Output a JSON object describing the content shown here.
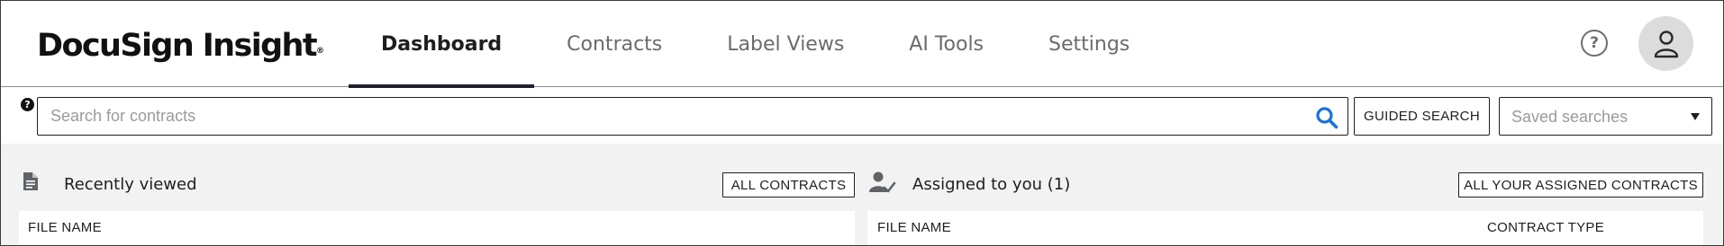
{
  "brand": {
    "name": "DocuSign Insight",
    "trademark": "®"
  },
  "nav": {
    "tabs": [
      {
        "label": "Dashboard",
        "active": true
      },
      {
        "label": "Contracts",
        "active": false
      },
      {
        "label": "Label Views",
        "active": false
      },
      {
        "label": "AI Tools",
        "active": false
      },
      {
        "label": "Settings",
        "active": false
      }
    ]
  },
  "header": {
    "help_icon": "question-circle-icon",
    "help_glyph": "?",
    "avatar_icon": "user-icon"
  },
  "search": {
    "help_glyph": "?",
    "placeholder": "Search for contracts",
    "value": "",
    "search_icon": "magnifier-icon",
    "guided_search_label": "GUIDED SEARCH",
    "saved_searches": {
      "placeholder": "Saved searches",
      "icon": "caret-down-icon"
    }
  },
  "recently_viewed": {
    "icon": "document-icon",
    "title": "Recently viewed",
    "button_label": "ALL CONTRACTS",
    "columns": [
      "FILE NAME"
    ]
  },
  "assigned": {
    "icon": "user-check-icon",
    "title": "Assigned to you (1)",
    "button_label": "ALL YOUR ASSIGNED CONTRACTS",
    "columns": [
      "FILE NAME",
      "CONTRACT TYPE"
    ]
  },
  "colors": {
    "accent_blue": "#1a73d9",
    "text_dark": "#1e1e1e",
    "text_muted": "#6b6b6b",
    "content_bg": "#f2f2f2",
    "avatar_bg": "#dcdcdc"
  }
}
